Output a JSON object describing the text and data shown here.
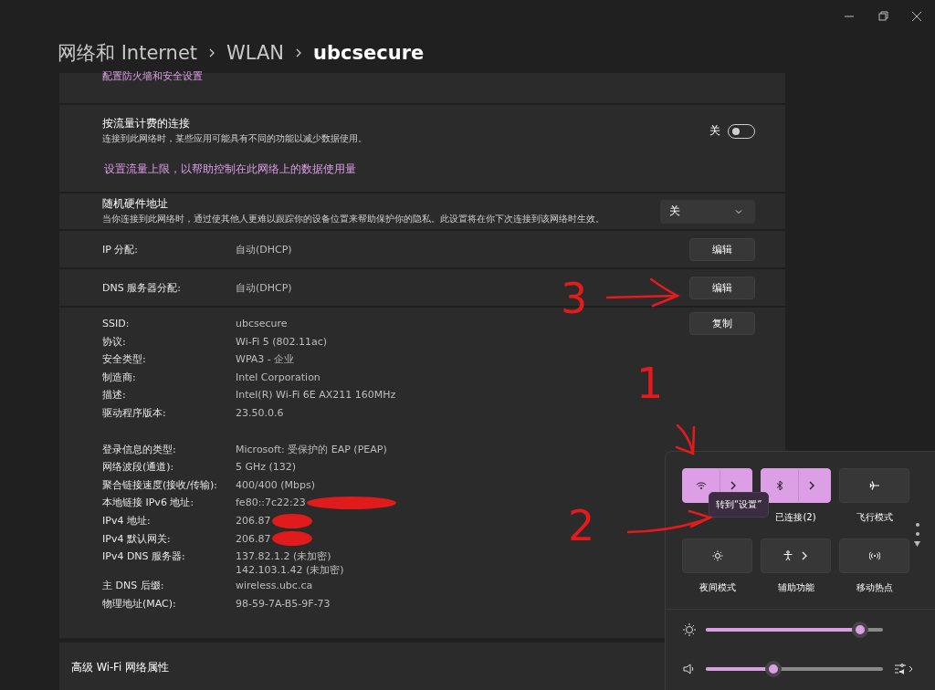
{
  "breadcrumb": [
    {
      "label": "网络和 Internet",
      "current": false
    },
    {
      "label": "WLAN",
      "current": false
    },
    {
      "label": "ubcsecure",
      "current": true
    }
  ],
  "firewall_link": "配置防火墙和安全设置",
  "metered": {
    "title": "按流量计费的连接",
    "description": "连接到此网络时，某些应用可能具有不同的功能以减少数据使用。",
    "state_label": "关",
    "on": false,
    "link": "设置流量上限，以帮助控制在此网络上的数据使用量"
  },
  "random_hw": {
    "title": "随机硬件地址",
    "description": "当你连接到此网络时，通过使其他人更难以跟踪你的设备位置来帮助保护你的隐私。此设置将在你下次连接到该网络时生效。",
    "value": "关"
  },
  "assignments": [
    {
      "label": "IP 分配:",
      "value": "自动(DHCP)",
      "button": "编辑"
    },
    {
      "label": "DNS 服务器分配:",
      "value": "自动(DHCP)",
      "button": "编辑"
    }
  ],
  "copy_button": "复制",
  "properties": [
    [
      {
        "label": "SSID:",
        "values": [
          "ubcsecure"
        ]
      },
      {
        "label": "协议:",
        "values": [
          "Wi-Fi 5 (802.11ac)"
        ]
      },
      {
        "label": "安全类型:",
        "values": [
          "WPA3 - 企业"
        ]
      },
      {
        "label": "制造商:",
        "values": [
          "Intel Corporation"
        ]
      },
      {
        "label": "描述:",
        "values": [
          "Intel(R) Wi-Fi 6E AX211 160MHz"
        ]
      },
      {
        "label": "驱动程序版本:",
        "values": [
          "23.50.0.6"
        ]
      }
    ],
    [
      {
        "label": "登录信息的类型:",
        "values": [
          "Microsoft: 受保护的 EAP (PEAP)"
        ]
      },
      {
        "label": "网络波段(通道):",
        "values": [
          "5 GHz (132)"
        ]
      },
      {
        "label": "聚合链接速度(接收/传输):",
        "values": [
          "400/400 (Mbps)"
        ]
      },
      {
        "label": "本地链接 IPv6 地址:",
        "values": [
          "fe80::7c22:23"
        ],
        "redacted": true
      },
      {
        "label": "IPv4 地址:",
        "values": [
          "206.87"
        ],
        "redacted": true
      },
      {
        "label": "IPv4 默认网关:",
        "values": [
          "206.87"
        ],
        "redacted": true
      },
      {
        "label": "IPv4 DNS 服务器:",
        "values": [
          "137.82.1.2 (未加密)",
          "142.103.1.42 (未加密)"
        ]
      },
      {
        "label": "主 DNS 后缀:",
        "values": [
          "wireless.ubc.ca"
        ]
      },
      {
        "label": "物理地址(MAC):",
        "values": [
          "98-59-7A-B5-9F-73"
        ]
      }
    ]
  ],
  "advanced": "高级 Wi-Fi 网络属性",
  "quick_settings": {
    "tiles": [
      {
        "kind": "split",
        "on": true
      },
      {
        "kind": "split",
        "on": true,
        "label": "已连接(2)"
      },
      {
        "kind": "toggle",
        "on": false,
        "label": "飞行模式"
      },
      {
        "kind": "toggle",
        "on": false,
        "label": "夜间模式"
      },
      {
        "kind": "expand",
        "on": false,
        "label": "辅助功能"
      },
      {
        "kind": "toggle",
        "on": false,
        "label": "移动热点"
      }
    ],
    "tooltip": "转到“设置”",
    "sliders": [
      {
        "level": 0.87
      },
      {
        "level": 0.38
      }
    ]
  },
  "annotations": [
    {
      "text": "3"
    },
    {
      "text": "1"
    },
    {
      "text": "2"
    }
  ]
}
